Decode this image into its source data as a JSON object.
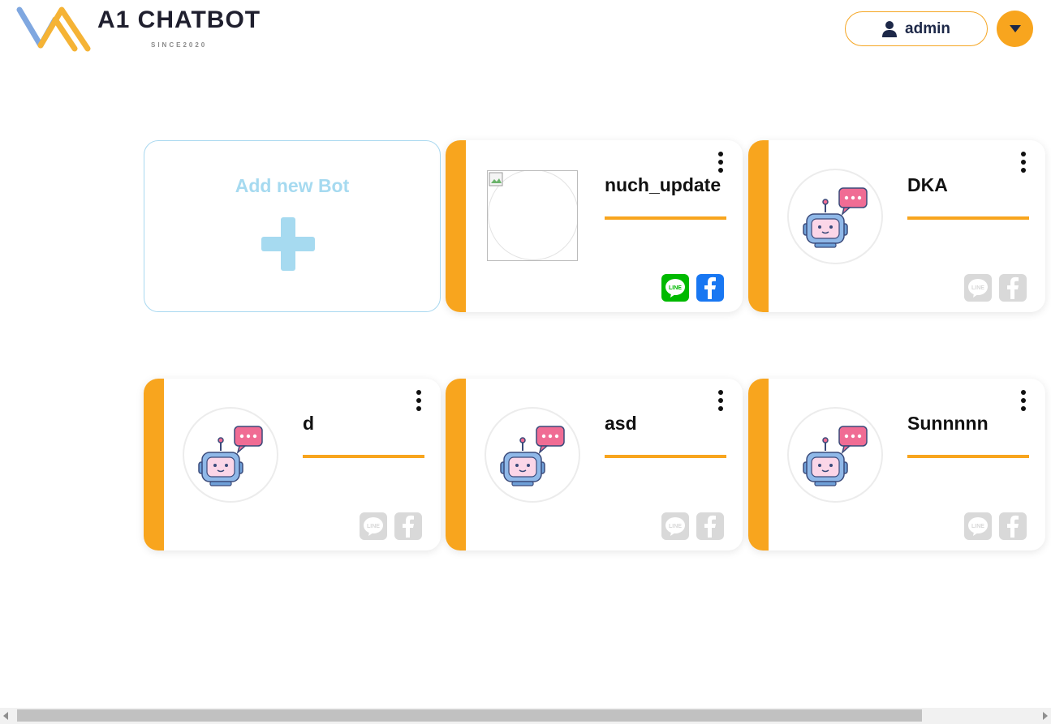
{
  "header": {
    "brand_title": "A1 CHATBOT",
    "brand_subtitle": "SINCE2020",
    "user_label": "admin"
  },
  "add_card": {
    "label": "Add new Bot"
  },
  "bots": [
    {
      "name": "nuch_update",
      "avatar": "broken-image",
      "line_connected": true,
      "facebook_connected": true
    },
    {
      "name": "DKA",
      "avatar": "robot",
      "line_connected": false,
      "facebook_connected": false
    },
    {
      "name": "d",
      "avatar": "robot",
      "line_connected": false,
      "facebook_connected": false
    },
    {
      "name": "asd",
      "avatar": "robot",
      "line_connected": false,
      "facebook_connected": false
    },
    {
      "name": "Sunnnnn",
      "avatar": "robot",
      "line_connected": false,
      "facebook_connected": false
    }
  ],
  "channel_icons": {
    "line": "LINE",
    "facebook": "facebook-icon"
  },
  "colors": {
    "accent": "#f8a51e",
    "add_card_blue": "#a6daf0",
    "line_green": "#00b900",
    "facebook_blue": "#1877f2",
    "disabled_gray": "#d9d9d9",
    "navy": "#1d2848"
  }
}
